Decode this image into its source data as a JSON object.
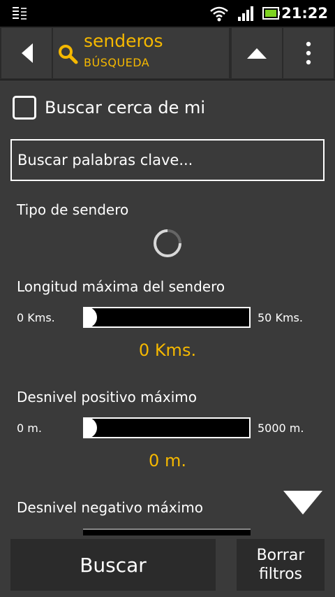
{
  "status_bar": {
    "time": "21:22",
    "icons": [
      "notification-icon",
      "wifi-icon",
      "signal-icon",
      "battery-icon"
    ]
  },
  "action_bar": {
    "title": "senderos",
    "subtitle": "BÚSQUEDA",
    "accent_color": "#f5b800",
    "icons": [
      "back-icon",
      "search-icon",
      "collapse-up-icon",
      "overflow-menu-icon"
    ]
  },
  "form": {
    "near_me": {
      "label": "Buscar cerca de mi",
      "checked": false
    },
    "keywords": {
      "placeholder": "Buscar palabras clave...",
      "value": ""
    },
    "trail_type": {
      "label": "Tipo de sendero",
      "loading": true
    },
    "max_length": {
      "label": "Longitud máxima del sendero",
      "min": "0 Kms.",
      "max": "50 Kms.",
      "value": "0 Kms.",
      "fraction": 0
    },
    "max_positive_gain": {
      "label": "Desnivel positivo máximo",
      "min": "0 m.",
      "max": "5000 m.",
      "value": "0 m.",
      "fraction": 0
    },
    "max_negative_gain": {
      "label": "Desnivel negativo máximo"
    }
  },
  "buttons": {
    "search": "Buscar",
    "clear_filters_line1": "Borrar",
    "clear_filters_line2": "filtros"
  }
}
